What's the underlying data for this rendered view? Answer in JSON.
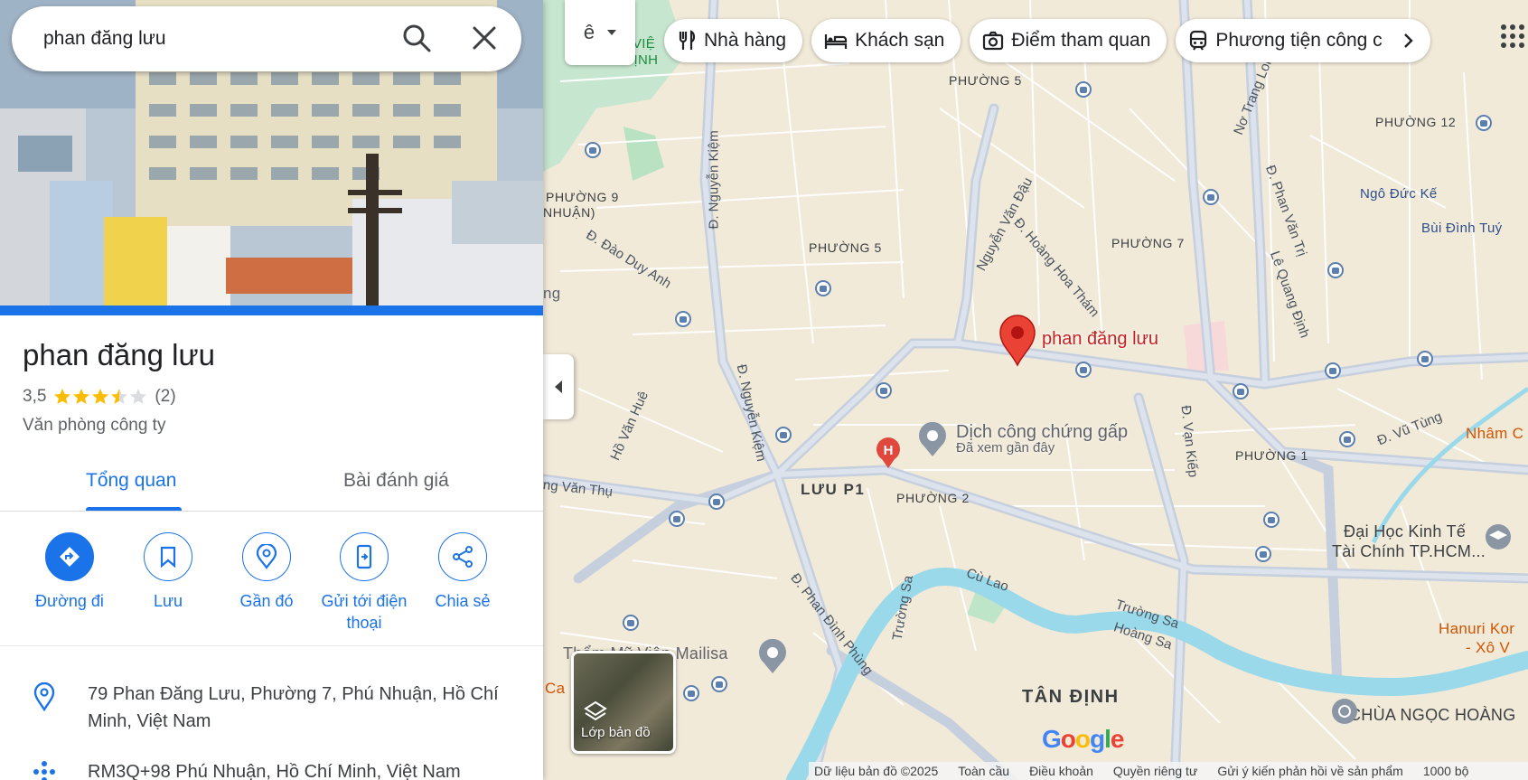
{
  "search": {
    "value": "phan đăng lưu"
  },
  "lang_button": {
    "label": "ê"
  },
  "chips": [
    {
      "label": "Nhà hàng",
      "icon": "restaurant-icon"
    },
    {
      "label": "Khách sạn",
      "icon": "hotel-icon"
    },
    {
      "label": "Điểm tham quan",
      "icon": "camera-icon"
    },
    {
      "label": "Phương tiện công c",
      "icon": "transit-icon"
    }
  ],
  "place": {
    "title": "phan đăng lưu",
    "rating": "3,5",
    "rating_value": 3.5,
    "review_count": "(2)",
    "category": "Văn phòng công ty"
  },
  "tabs": [
    {
      "label": "Tổng quan",
      "active": true
    },
    {
      "label": "Bài đánh giá",
      "active": false
    }
  ],
  "actions": [
    {
      "label": "Đường đi"
    },
    {
      "label": "Lưu"
    },
    {
      "label": "Gần đó"
    },
    {
      "label": "Gửi tới điện thoại"
    },
    {
      "label": "Chia sẻ"
    }
  ],
  "info": {
    "address": "79 Phan Đăng Lưu, Phường 7, Phú Nhuận, Hồ Chí Minh, Việt Nam",
    "plus_code": "RM3Q+98 Phú Nhuận, Hồ Chí Minh, Việt Nam"
  },
  "map": {
    "pin_label": "phan đăng lưu",
    "poi_name": "Dịch công chứng gấp",
    "poi_sub": "Đã xem gần đây",
    "layers_label": "Lớp bản đồ",
    "labels": {
      "p5_top": "PHƯỜNG 5",
      "p12": "PHƯỜNG 12",
      "p9": "PHƯỜNG 9",
      "p9b": "NHUẬN)",
      "p5_mid": "PHƯỜNG 5",
      "p7": "PHƯỜNG 7",
      "p1": "PHƯỜNG 1",
      "p2": "PHƯỜNG 2",
      "luu_p1": "LƯU P1",
      "tan_dinh": "TÂN ĐỊNH",
      "ngo_duc_ke": "Ngô Đức Kế",
      "bui_dinh_tuy": "Bùi Đình Tuý",
      "nham": "Nhâm C",
      "dai_hoc": "Đại Học Kinh Tế",
      "dai_hoc2": "Tài Chính TP.HCM...",
      "hanuri": "Hanuri Kor",
      "hanuri2": "- Xô V",
      "chua": "CHÙA NGỌC HOÀNG",
      "mailisa": "Thẩm Mỹ Viện Mailisa",
      "viet": "VIỆ",
      "gia_dinh": "GIA ĐỊNH",
      "ng": "ng",
      "ca": "Ca"
    },
    "streets": {
      "nguyen_kiem_top": "Đ. Nguyễn Kiệm",
      "nguyen_kiem_mid": "Đ. Nguyễn Kiệm",
      "dao_duy_anh": "Đ. Đào Duy Anh",
      "ho_van_hue": "Hồ Văn Huê",
      "hoang_van_thu": "ng Văn Thụ",
      "nguyen_van_dau": "Nguyễn Văn Đậu",
      "hoang_hoa_tham": "Đ. Hoàng Hoa Thám",
      "no_trang_long": "Nơ Trang Long",
      "phan_van_tri": "Đ. Phan Văn Trị",
      "le_quang_dinh": "Lê Quang Định",
      "van_kiep": "Đ. Vạn Kiếp",
      "vu_tung": "Đ. Vũ Tùng",
      "cu_lao": "Cù Lao",
      "truong_sa_left": "Trường Sa",
      "truong_sa_right": "Trường Sa",
      "hoang_sa": "Hoàng Sa",
      "phan_dinh_phung": "Đ. Phan Đình Phùng"
    },
    "footer": [
      "Dữ liệu bản đồ ©2025",
      "Toàn cầu",
      "Điều khoản",
      "Quyền riêng tư",
      "Gửi ý kiến phản hồi về sản phẩm",
      "1000 bộ"
    ],
    "logo": "Google"
  }
}
